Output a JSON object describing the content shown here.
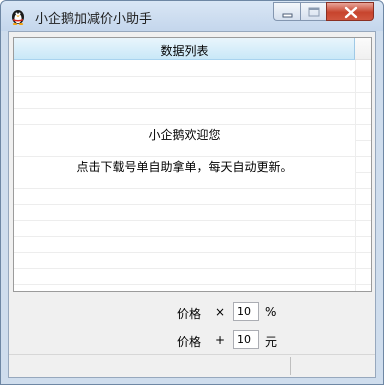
{
  "window": {
    "title": "小企鹅加减价小助手",
    "icon": "penguin-icon"
  },
  "controls": {
    "minimize_icon": "minimize-icon",
    "maximize_icon": "maximize-icon",
    "close_icon": "close-icon"
  },
  "list": {
    "header": "数据列表",
    "welcome": "小企鹅欢迎您",
    "notice": "点击下载号单自助拿单，每天自动更新。"
  },
  "form": {
    "multiply": {
      "label": "价格",
      "operator": "×",
      "value": "10",
      "unit": "%"
    },
    "add": {
      "label": "价格",
      "operator": "+",
      "value": "10",
      "unit": "元"
    }
  },
  "colors": {
    "titlebar": "#cfdded",
    "header_bg": "#c9e8f8",
    "close_button": "#c7442d"
  }
}
